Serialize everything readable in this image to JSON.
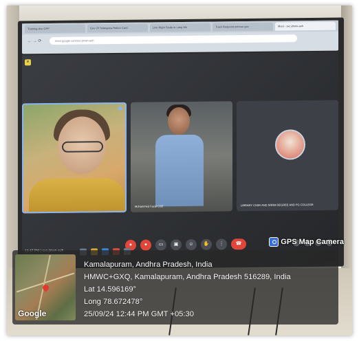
{
  "browser": {
    "tabs": [
      "Training.xlsx GPP",
      "Gov Of Telangana Ration Card",
      "Live Right Study in Lang Mo",
      "Track Requests person gov",
      "Meet - sxc-jmwn-aoh",
      "Meet - sxc-jmwn-aoh"
    ],
    "address": "meet.google.com/sxc-jmwn-aoh"
  },
  "meeting": {
    "tile_labels": [
      "",
      "Mohammed Fazal CSE",
      "LIBRARY CSSR AND SRRM DEGREE AND PG COLLEGE"
    ],
    "clock": "12:47 PM | sxc-jmwn-auh"
  },
  "gps": {
    "app_label": "GPS Map Camera",
    "map_brand": "Google",
    "place": "Kamalapuram, Andhra Pradesh, India",
    "address": "HMWC+GXQ, Kamalapuram, Andhra Pradesh 516289, India",
    "lat": "Lat 14.596169°",
    "long": "Long 78.672478°",
    "datetime": "25/09/24 12:44 PM GMT +05:30"
  },
  "icons": [
    "gps-camera-icon",
    "map-pin-icon",
    "mic-off-icon",
    "camera-off-icon",
    "hand-raise-icon",
    "leave-call-icon"
  ]
}
